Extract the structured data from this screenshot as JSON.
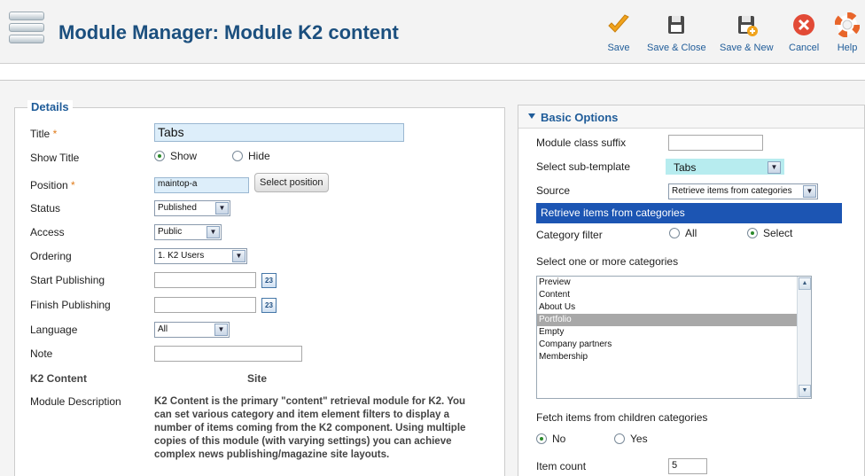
{
  "header": {
    "title": "Module Manager: Module K2 content",
    "buttons": [
      {
        "label": "Save",
        "icon": "check-icon",
        "color": "#f0a31c"
      },
      {
        "label": "Save & Close",
        "icon": "floppy-icon"
      },
      {
        "label": "Save & New",
        "icon": "floppy-plus-icon"
      },
      {
        "label": "Cancel",
        "icon": "cancel-icon",
        "color": "#e24a36"
      },
      {
        "label": "Help",
        "icon": "lifebuoy-icon",
        "color": "#e8652a"
      }
    ]
  },
  "details": {
    "legend": "Details",
    "title_label": "Title",
    "title_value": "Tabs",
    "show_title_label": "Show Title",
    "show_title_options": [
      "Show",
      "Hide"
    ],
    "show_title_selected": "Show",
    "position_label": "Position",
    "position_value": "maintop-a",
    "select_position_button": "Select position",
    "status_label": "Status",
    "status_value": "Published",
    "access_label": "Access",
    "access_value": "Public",
    "ordering_label": "Ordering",
    "ordering_value": "1. K2 Users",
    "start_publishing_label": "Start Publishing",
    "start_publishing_value": "",
    "finish_publishing_label": "Finish Publishing",
    "finish_publishing_value": "",
    "language_label": "Language",
    "language_value": "All",
    "note_label": "Note",
    "note_value": "",
    "k2_content_label": "K2 Content",
    "site_label": "Site",
    "module_description_label": "Module Description",
    "module_description": "K2 Content is the primary \"content\" retrieval module for K2. You can set various category and item element filters to display a number of items coming from the K2 component. Using multiple copies of this module (with varying settings) you can achieve complex news publishing/magazine site layouts."
  },
  "basic_options": {
    "header": "Basic Options",
    "module_class_suffix_label": "Module class suffix",
    "module_class_suffix_value": "",
    "sub_template_label": "Select sub-template",
    "sub_template_value": "Tabs",
    "source_label": "Source",
    "source_value": "Retrieve items from categories",
    "source_bar": "Retrieve items from categories",
    "category_filter_label": "Category filter",
    "category_filter_options": [
      "All",
      "Select"
    ],
    "category_filter_selected": "Select",
    "categories_label": "Select one or more categories",
    "categories": [
      "Preview",
      "Content",
      "About Us",
      "Portfolio",
      "Empty",
      "Company partners",
      "Membership"
    ],
    "categories_selected": "Portfolio",
    "fetch_children_label": "Fetch items from children categories",
    "fetch_children_options": [
      "No",
      "Yes"
    ],
    "fetch_children_selected": "No",
    "item_count_label": "Item count",
    "item_count_value": "5"
  },
  "colors": {
    "title_blue": "#1b4f7e",
    "link_blue": "#1f5c99",
    "source_bar": "#1c55b3",
    "required": "#e07b1a"
  }
}
